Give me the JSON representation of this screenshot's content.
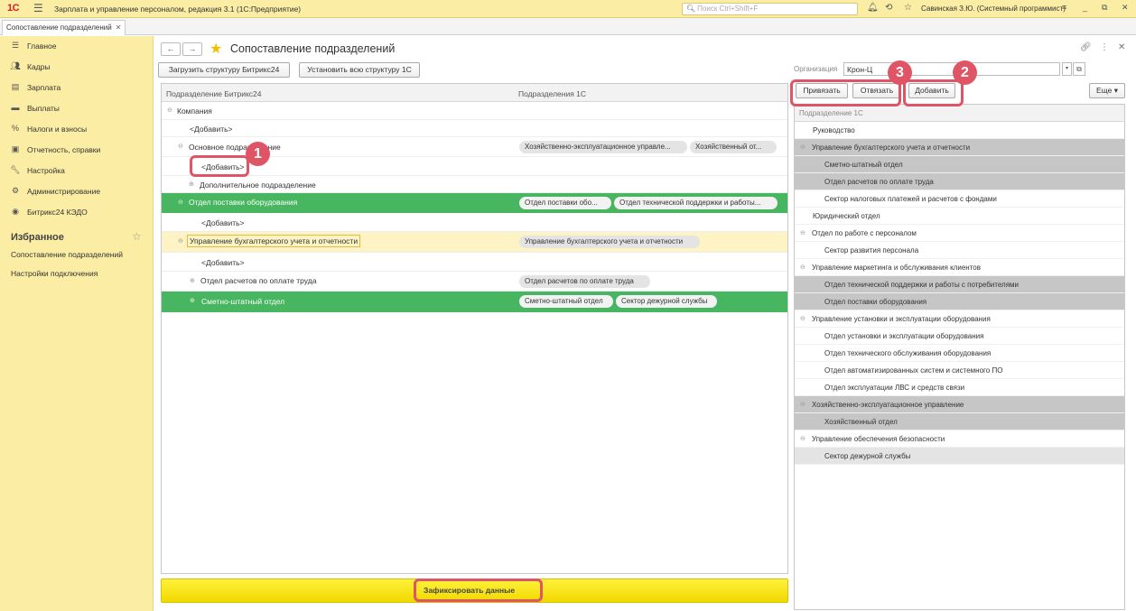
{
  "window": {
    "logo": "1С",
    "title": "Зарплата и управление персоналом, редакция 3.1  (1С:Предприятие)",
    "search_placeholder": "Поиск Ctrl+Shift+F",
    "user": "Савинская З.Ю. (Системный программист)"
  },
  "tabs": [
    {
      "label": "Сопоставление подразделений"
    }
  ],
  "sidebar": {
    "items": [
      {
        "label": "Главное",
        "icon": "menu-icon"
      },
      {
        "label": "Кадры",
        "icon": "people-icon"
      },
      {
        "label": "Зарплата",
        "icon": "ledger-icon"
      },
      {
        "label": "Выплаты",
        "icon": "card-icon"
      },
      {
        "label": "Налоги и взносы",
        "icon": "percent-icon"
      },
      {
        "label": "Отчетность, справки",
        "icon": "report-icon"
      },
      {
        "label": "Настройка",
        "icon": "wrench-icon"
      },
      {
        "label": "Администрирование",
        "icon": "gear-icon"
      },
      {
        "label": "Битрикс24 КЭДО",
        "icon": "bitrix-icon"
      }
    ],
    "favorites_title": "Избранное",
    "favorites": [
      "Сопоставление подразделений",
      "Настройки подключения"
    ]
  },
  "page": {
    "title": "Сопоставление подразделений",
    "load_button": "Загрузить структуру Битрикс24",
    "set_button": "Установить всю структуру 1С",
    "org_label": "Организация",
    "org_value": "Крон-Ц",
    "bind_button": "Привязать",
    "unbind_button": "Отвязать",
    "add_button": "Добавить",
    "more_button": "Еще",
    "fix_button": "Зафиксировать данные"
  },
  "left_table": {
    "col1": "Подразделение Битрикс24",
    "col2": "Подразделения 1С",
    "rows": [
      {
        "text": "Компания",
        "toggle": "⊖",
        "chips": []
      },
      {
        "text": "<Добавить>",
        "toggle": "",
        "chips": []
      },
      {
        "text": "Основное подразделение",
        "toggle": "⊖",
        "chips": [
          "Хозяйственно-эксплуатационное управле...",
          "Хозяйственный от..."
        ]
      },
      {
        "text": "<Добавить>",
        "toggle": "",
        "chips": []
      },
      {
        "text": "Дополнительное подразделение",
        "toggle": "⊕",
        "chips": []
      },
      {
        "text": "Отдел поставки оборудования",
        "toggle": "⊖",
        "chips": [
          "Отдел поставки обо...",
          "Отдел технической поддержки и работы..."
        ]
      },
      {
        "text": "<Добавить>",
        "toggle": "",
        "chips": []
      },
      {
        "text": "Управление бухгалтерского учета и отчетности",
        "toggle": "⊖",
        "chips": [
          "Управление бухгалтерского учета и отчетности"
        ]
      },
      {
        "text": "<Добавить>",
        "toggle": "",
        "chips": []
      },
      {
        "text": "Отдел расчетов по оплате труда",
        "toggle": "⊕",
        "chips": [
          "Отдел расчетов по оплате труда"
        ]
      },
      {
        "text": "Сметно-штатный отдел",
        "toggle": "⊕",
        "chips": [
          "Сметно-штатный отдел",
          "Сектор дежурной службы"
        ]
      }
    ]
  },
  "right_table": {
    "header": "Подразделение 1С",
    "rows": [
      {
        "text": "Руководство",
        "toggle": ""
      },
      {
        "text": "Управление бухгалтерского учета и отчетности",
        "toggle": "⊖"
      },
      {
        "text": "Сметно-штатный отдел",
        "toggle": ""
      },
      {
        "text": "Отдел расчетов по оплате труда",
        "toggle": ""
      },
      {
        "text": "Сектор налоговых платежей и расчетов с фондами",
        "toggle": ""
      },
      {
        "text": "Юридический отдел",
        "toggle": ""
      },
      {
        "text": "Отдел по работе с персоналом",
        "toggle": "⊖"
      },
      {
        "text": "Сектор развития персонала",
        "toggle": ""
      },
      {
        "text": "Управление маркетинга и обслуживания клиентов",
        "toggle": "⊖"
      },
      {
        "text": "Отдел технической поддержки и работы с потребителями",
        "toggle": ""
      },
      {
        "text": "Отдел поставки оборудования",
        "toggle": ""
      },
      {
        "text": "Управление установки и эксплуатации оборудования",
        "toggle": "⊖"
      },
      {
        "text": "Отдел установки и эксплуатации оборудования",
        "toggle": ""
      },
      {
        "text": "Отдел технического обслуживания оборудования",
        "toggle": ""
      },
      {
        "text": "Отдел автоматизированных систем и системного ПО",
        "toggle": ""
      },
      {
        "text": "Отдел эксплуатации ЛВС и средств связи",
        "toggle": ""
      },
      {
        "text": "Хозяйственно-эксплуатационное управление",
        "toggle": "⊖"
      },
      {
        "text": "Хозяйственный отдел",
        "toggle": ""
      },
      {
        "text": "Управление обеспечения безопасности",
        "toggle": "⊖"
      },
      {
        "text": "Сектор дежурной службы",
        "toggle": ""
      }
    ]
  },
  "callouts": [
    "1",
    "2",
    "3"
  ],
  "colors": {
    "mapped_row": "#48b560",
    "selected_row": "#fdf3c4",
    "callout": "#e05565",
    "panel": "#fbeda3"
  }
}
